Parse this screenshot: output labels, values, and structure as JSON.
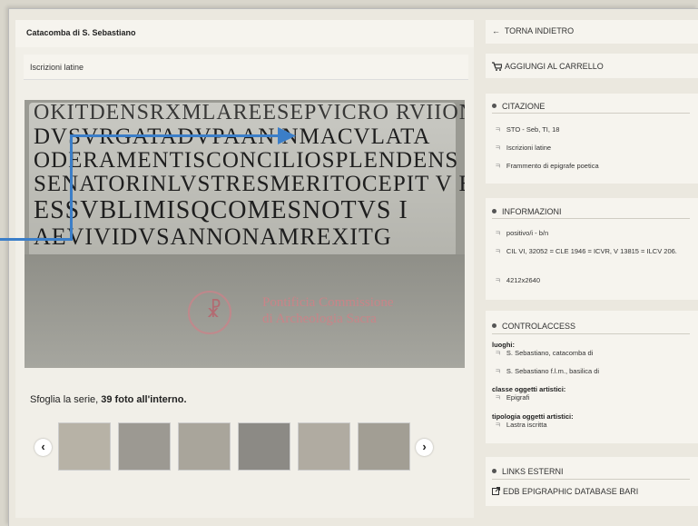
{
  "header": {
    "title": "Catacomba di S. Sebastiano"
  },
  "section": {
    "title": "Iscrizioni latine"
  },
  "image": {
    "inscription_lines": [
      "OKITDENSRXMLAREESEPVICRO RVIION",
      "DVSVRGATADVPAAN NMACVLATA",
      "ODERAMENTISCONCILIOSPLENDENS P",
      "SENATORINLVSTRESMERITOCEPIT V E",
      "ESSVBLIMISQCOMESNOTVS I",
      "AEVIVIDVSANNONAMREXITG"
    ],
    "watermark_line1": "Pontificia Commissione",
    "watermark_line2": "di Archeologia Sacra"
  },
  "gallery": {
    "prefix": "Sfoglia la serie, ",
    "count_text": "39 foto all'interno.",
    "prev": "‹",
    "next": "›"
  },
  "sidebar": {
    "back": "TORNA INDIETRO",
    "back_icon": "←",
    "cart": "AGGIUNGI AL CARRELLO",
    "citazione": {
      "title": "CITAZIONE",
      "items": [
        "STO - Seb, TI, 18",
        "Iscrizioni latine",
        "Frammento di epigrafe poetica"
      ]
    },
    "informazioni": {
      "title": "INFORMAZIONI",
      "items": [
        "positivo/i - b/n",
        "CIL VI, 32052 = CLE 1946 = ICVR, V 13815 = ILCV 206.",
        "4212x2640"
      ]
    },
    "controlaccess": {
      "title": "CONTROLACCESS",
      "luoghi_label": "luoghi:",
      "luoghi": [
        "S. Sebastiano, catacomba di",
        "S. Sebastiano f.l.m., basilica di"
      ],
      "classe_label": "classe oggetti artistici:",
      "classe": [
        "Epigrafi"
      ],
      "tipologia_label": "tipologia oggetti artistici:",
      "tipologia": [
        "Lastra iscritta"
      ]
    },
    "links": {
      "title": "LINKS ESTERNI",
      "edb": "EDB EPIGRAPHIC DATABASE BARI"
    }
  }
}
